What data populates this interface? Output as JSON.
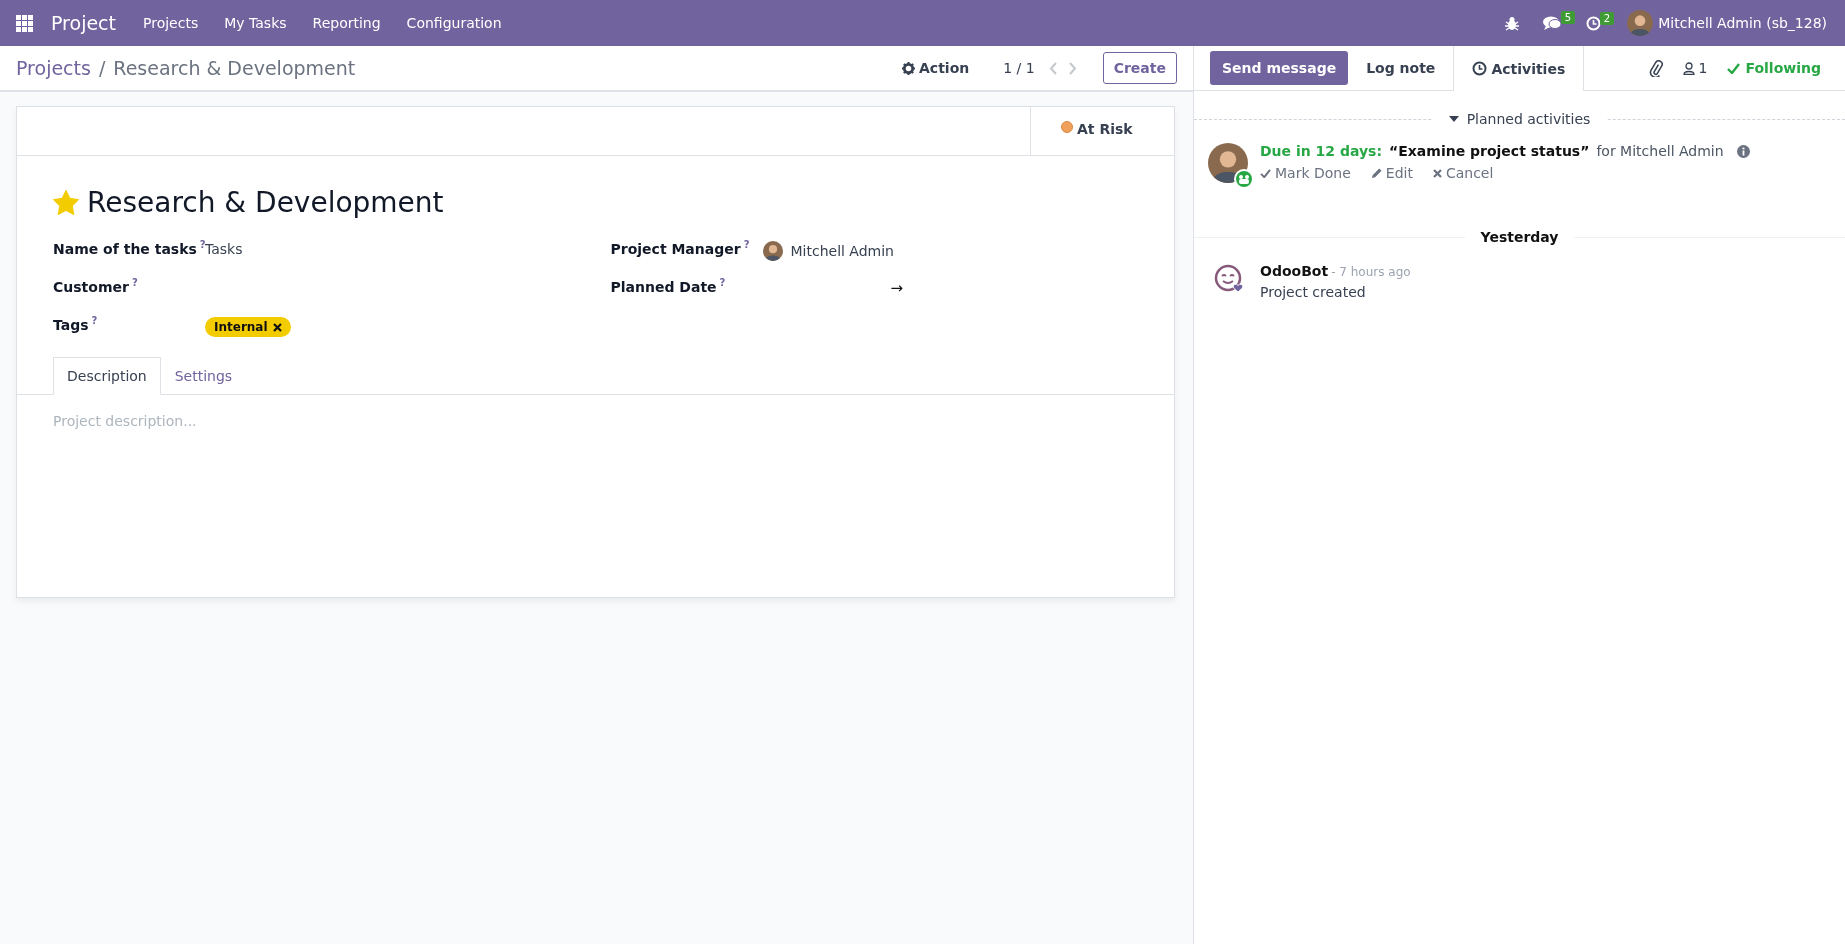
{
  "navbar": {
    "app_name": "Project",
    "menu": [
      "Projects",
      "My Tasks",
      "Reporting",
      "Configuration"
    ],
    "systray": [
      {
        "kind": "debug"
      },
      {
        "kind": "messages",
        "count": "5"
      },
      {
        "kind": "activities",
        "count": "2"
      }
    ],
    "user": "Mitchell Admin (sb_128)"
  },
  "breadcrumb": {
    "parent": "Projects",
    "separator": "/",
    "current": "Research & Development"
  },
  "control_panel": {
    "action": "Action",
    "pager": "1 / 1",
    "create": "Create"
  },
  "form": {
    "status": "At Risk",
    "favorite": true,
    "title": "Research & Development",
    "fields_left": [
      {
        "kind": "text",
        "label": "Name of the tasks",
        "help": "?",
        "value": "Tasks"
      },
      {
        "kind": "text",
        "label": "Customer",
        "help": "?"
      },
      {
        "kind": "tags",
        "label": "Tags",
        "help": "?",
        "tags": [
          "Internal"
        ]
      }
    ],
    "fields_right": [
      {
        "kind": "user",
        "label": "Project Manager",
        "help": "?",
        "value": "Mitchell Admin"
      },
      {
        "kind": "daterange",
        "label": "Planned Date",
        "help": "?",
        "separator": "→"
      }
    ],
    "tabs": [
      {
        "label": "Description",
        "selected": true
      },
      {
        "label": "Settings",
        "selected": false
      }
    ],
    "description_placeholder": "Project description..."
  },
  "chatter": {
    "buttons": [
      {
        "kind": "primary",
        "label": "Send message"
      },
      {
        "kind": "tab",
        "label": "Log note"
      },
      {
        "kind": "activities",
        "label": "Activities"
      }
    ],
    "followers": "1",
    "following": "Following",
    "planned": {
      "title": "Planned activities",
      "expanded": true,
      "activities": [
        {
          "due": "Due in 12 days:",
          "summary": "“Examine project status”",
          "assignee": "for Mitchell Admin",
          "actions": [
            {
              "kind": "done",
              "label": "Mark Done"
            },
            {
              "kind": "edit",
              "label": "Edit"
            },
            {
              "kind": "cancel",
              "label": "Cancel"
            }
          ]
        }
      ]
    },
    "date_separator": "Yesterday",
    "messages": [
      {
        "author": "OdooBot",
        "time": "- 7 hours ago",
        "body": "Project created"
      }
    ]
  }
}
